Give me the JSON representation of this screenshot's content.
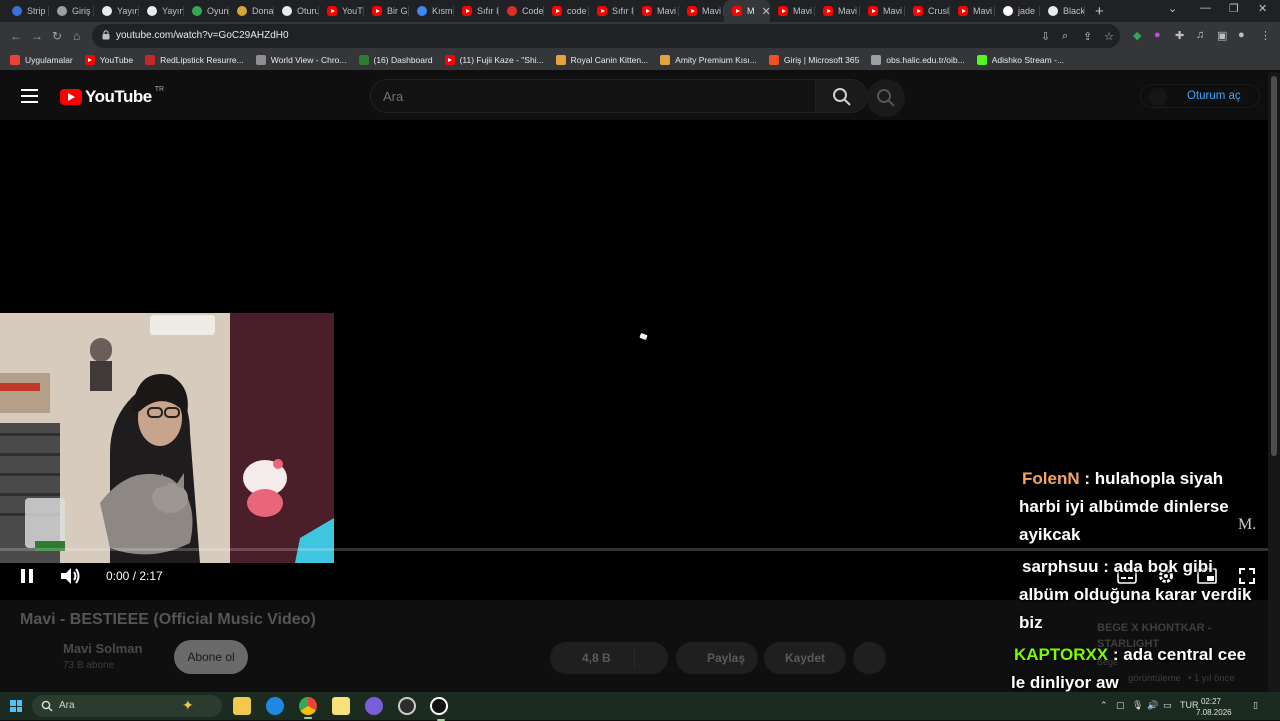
{
  "browser": {
    "tabs": [
      {
        "label": "Strip",
        "favicon": "windows-icon",
        "color": "#3b6fd9"
      },
      {
        "label": "Giriş",
        "favicon": "hemp-icon",
        "color": "#9aa0a6"
      },
      {
        "label": "Yayın",
        "favicon": "diamond-icon",
        "color": "#e8eaed"
      },
      {
        "label": "Yayın",
        "favicon": "diamond-icon",
        "color": "#e8eaed"
      },
      {
        "label": "Oyun",
        "favicon": "drive-icon",
        "color": "#34a853"
      },
      {
        "label": "Dona",
        "favicon": "donation-icon",
        "color": "#d9a53b"
      },
      {
        "label": "Oturu",
        "favicon": "tiktok-icon",
        "color": "#e8eaed"
      },
      {
        "label": "YouTu",
        "favicon": "youtube-icon",
        "color": "#ff0000"
      },
      {
        "label": "Bir G",
        "favicon": "youtube-icon",
        "color": "#ff0000"
      },
      {
        "label": "Kısm",
        "favicon": "gear-icon",
        "color": "#4285f4"
      },
      {
        "label": "Sıfır I",
        "favicon": "youtube-icon",
        "color": "#ff0000"
      },
      {
        "label": "Code",
        "favicon": "triangle-icon",
        "color": "#d93025"
      },
      {
        "label": "code",
        "favicon": "youtube-icon",
        "color": "#ff0000"
      },
      {
        "label": "Sıfır I",
        "favicon": "youtube-icon",
        "color": "#ff0000"
      },
      {
        "label": "Mavi",
        "favicon": "youtube-icon",
        "color": "#ff0000"
      },
      {
        "label": "Mavi",
        "favicon": "youtube-icon",
        "color": "#ff0000"
      },
      {
        "label": "M",
        "favicon": "youtube-icon",
        "color": "#ff0000",
        "active": true
      },
      {
        "label": "Mavi",
        "favicon": "youtube-icon",
        "color": "#ff0000"
      },
      {
        "label": "Mavi",
        "favicon": "youtube-icon",
        "color": "#ff0000"
      },
      {
        "label": "Mavi",
        "favicon": "youtube-icon",
        "color": "#ff0000"
      },
      {
        "label": "Crusl",
        "favicon": "youtube-icon",
        "color": "#ff0000"
      },
      {
        "label": "Mavi",
        "favicon": "youtube-icon",
        "color": "#ff0000"
      },
      {
        "label": "jade",
        "favicon": "google-icon",
        "color": "#ffffff"
      },
      {
        "label": "Black",
        "favicon": "page-icon",
        "color": "#e8eaed"
      }
    ],
    "url": "youtube.com/watch?v=GoC29AHZdH0",
    "bookmarks": [
      {
        "label": "Uygulamalar",
        "icon": "apps-grid-icon",
        "color": "#ea4335"
      },
      {
        "label": "YouTube",
        "icon": "youtube-icon",
        "color": "#ff0000"
      },
      {
        "label": "RedLipstick Resurre...",
        "icon": "bookmark-red-icon",
        "color": "#c62828"
      },
      {
        "label": "World View - Chro...",
        "icon": "bookmark-world-icon",
        "color": "#8e8e8e"
      },
      {
        "label": "(16) Dashboard",
        "icon": "bookmark-dashboard-icon",
        "color": "#2e7d32"
      },
      {
        "label": "(11) Fujii Kaze - \"Shi...",
        "icon": "youtube-icon",
        "color": "#ff0000"
      },
      {
        "label": "Royal Canin Kitten...",
        "icon": "bookmark-shop-icon",
        "color": "#e6a23c"
      },
      {
        "label": "Amity Premium Kısı...",
        "icon": "bookmark-shop-icon",
        "color": "#e6a23c"
      },
      {
        "label": "Giriş | Microsoft 365",
        "icon": "microsoft-icon",
        "color": "#f25022"
      },
      {
        "label": "obs.halic.edu.tr/oib...",
        "icon": "globe-icon",
        "color": "#9aa0a6"
      },
      {
        "label": "Adishko Stream -...",
        "icon": "kick-icon",
        "color": "#53fc18"
      }
    ]
  },
  "youtube": {
    "region": "TR",
    "search_placeholder": "Ara",
    "signin_label": "Oturum aç"
  },
  "player": {
    "time": "0:00 / 2:17",
    "progress_fraction": 0.0,
    "watermark": "M.",
    "chat": [
      {
        "user": "FolenN",
        "sep": " : ",
        "lines": [
          "hulahopla siyah",
          "harbi iyi albümde dinlerse",
          "ayikcak"
        ],
        "color": "#f4a460"
      },
      {
        "user": "sarphsuu",
        "sep": " : ",
        "lines": [
          "ada bok gibi",
          "albüm olduğuna karar verdik",
          "biz"
        ],
        "color": "#ffffff"
      },
      {
        "user": "KAPTORXX",
        "sep": " : ",
        "lines": [
          "ada central cee",
          "le dinliyor aw"
        ],
        "color": "#7cfc00"
      }
    ]
  },
  "video_info": {
    "title": "Mavi - BESTIEEE (Official Music Video)",
    "channel": "Mavi Solman",
    "subscribers": "73 B abone",
    "subscribe_label": "Abone ol",
    "likes": "4,8 B",
    "share_label": "Paylaş",
    "save_label": "Kaydet"
  },
  "sidebar": {
    "next_title_1": "BEGE X KHONTKAR -",
    "next_title_2": "STARLIGHT",
    "next_channel": "Bege",
    "next_meta_views": "görüntüleme",
    "next_meta_age": "• 1 yıl önce"
  },
  "taskbar": {
    "search_placeholder": "Ara",
    "language": "TUR",
    "time": "02:27",
    "date": "7.08.2026"
  }
}
